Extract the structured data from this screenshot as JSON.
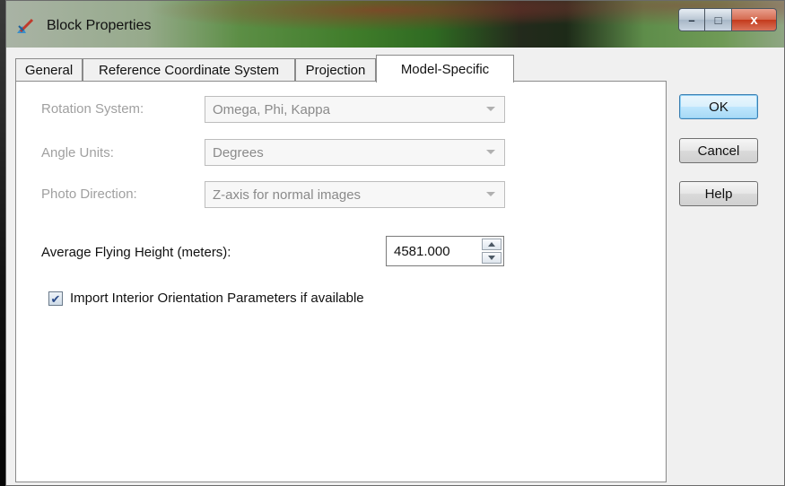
{
  "window": {
    "title": "Block Properties",
    "controls": {
      "minimize": "–",
      "maximize": "□",
      "close": "x"
    }
  },
  "tabs": [
    {
      "label": "General",
      "active": false
    },
    {
      "label": "Reference Coordinate System",
      "active": false
    },
    {
      "label": "Projection",
      "active": false
    },
    {
      "label": "Model-Specific",
      "active": true
    }
  ],
  "model_specific": {
    "rotation_system": {
      "label": "Rotation System:",
      "value": "Omega, Phi, Kappa",
      "enabled": false
    },
    "angle_units": {
      "label": "Angle Units:",
      "value": "Degrees",
      "enabled": false
    },
    "photo_direction": {
      "label": "Photo Direction:",
      "value": "Z-axis for normal images",
      "enabled": false
    },
    "flying_height": {
      "label": "Average Flying Height (meters):",
      "value": "4581.000"
    },
    "import_interior": {
      "label": "Import Interior Orientation Parameters if available",
      "checked": true
    }
  },
  "buttons": {
    "ok": "OK",
    "cancel": "Cancel",
    "help": "Help"
  },
  "icons": {
    "app": "block-properties-icon"
  }
}
